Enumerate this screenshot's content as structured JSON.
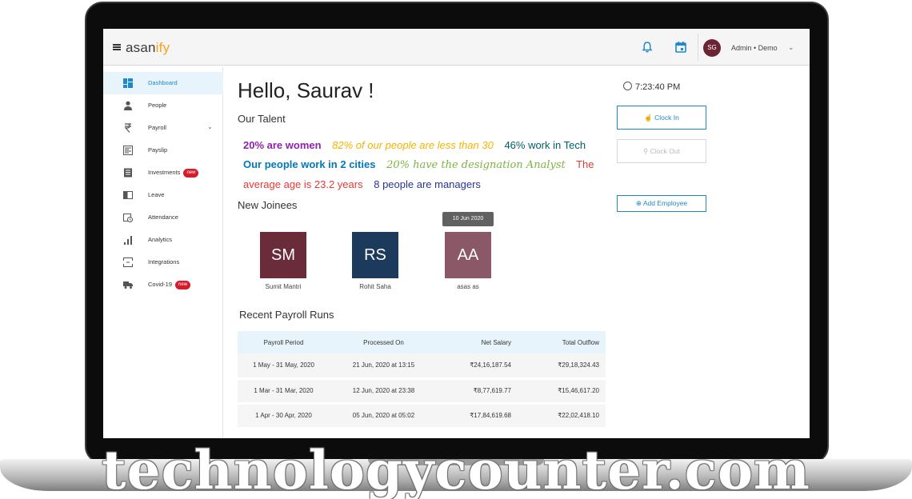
{
  "header": {
    "logo_main": "asan",
    "logo_accent": "ify",
    "user_initials": "SG",
    "user_label": "Admin • Demo"
  },
  "sidebar": {
    "items": [
      {
        "label": "Dashboard",
        "icon": "dashboard-icon",
        "active": true
      },
      {
        "label": "People",
        "icon": "person-icon"
      },
      {
        "label": "Payroll",
        "icon": "rupee-icon",
        "has_chevron": true
      },
      {
        "label": "Payslip",
        "icon": "payslip-icon"
      },
      {
        "label": "Investments",
        "icon": "document-icon",
        "badge": "new"
      },
      {
        "label": "Leave",
        "icon": "leave-icon"
      },
      {
        "label": "Attendance",
        "icon": "calendar-clock-icon"
      },
      {
        "label": "Analytics",
        "icon": "bar-chart-icon"
      },
      {
        "label": "Integrations",
        "icon": "integrations-icon"
      },
      {
        "label": "Covid-19",
        "icon": "truck-icon",
        "badge": "new"
      }
    ]
  },
  "main": {
    "greeting": "Hello, Saurav !",
    "talent_title": "Our Talent",
    "talent_stats": [
      {
        "text": "20% are women",
        "style": "purple"
      },
      {
        "text": "82% of our people are less than 30",
        "style": "yellow"
      },
      {
        "text": "46% work in Tech",
        "style": "teal"
      },
      {
        "text": "Our people work in 2 cities",
        "style": "cyan"
      },
      {
        "text": "20% have the designation Analyst",
        "style": "green"
      },
      {
        "text": "The average age is 23.2 years",
        "style": "red"
      },
      {
        "text": "8 people are managers",
        "style": "blue"
      }
    ],
    "joinees_title": "New Joinees",
    "joinees": [
      {
        "initials": "SM",
        "name": "Sumit Mantri",
        "color": "#6b2c3a"
      },
      {
        "initials": "RS",
        "name": "Rohit Saha",
        "color": "#1b3a5c"
      },
      {
        "initials": "AA",
        "name": "asas as",
        "color": "#8a5866"
      }
    ],
    "tooltip": "10 Jun 2020",
    "payroll_title": "Recent Payroll Runs",
    "payroll_columns": [
      "Payroll Period",
      "Processed On",
      "Net Salary",
      "Total Outflow"
    ],
    "payroll_rows": [
      [
        "1 May - 31 May, 2020",
        "21 Jun, 2020 at 13:15",
        "₹24,16,187.54",
        "₹29,18,324.43"
      ],
      [
        "1 Mar - 31 Mar, 2020",
        "12 Jun, 2020 at 23:38",
        "₹8,77,619.77",
        "₹15,46,617.20"
      ],
      [
        "1 Apr - 30 Apr, 2020",
        "05 Jun, 2020 at 05:02",
        "₹17,84,619.68",
        "₹22,02,418.10"
      ]
    ]
  },
  "right": {
    "time": "7:23:40 PM",
    "clock_in": "Clock In",
    "clock_out": "Clock Out",
    "add_employee": "Add Employee"
  },
  "colors": {
    "accent": "#1e88c8",
    "logo_accent": "#f7a21b",
    "badge": "#d61c2b",
    "active_bg": "#e8f4fc"
  },
  "watermark": "technologycounter.com"
}
